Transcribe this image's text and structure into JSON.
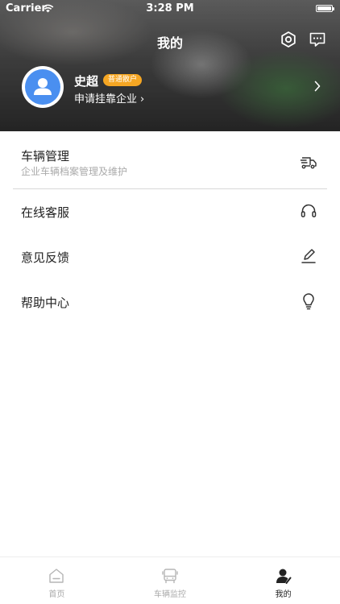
{
  "status_bar": {
    "carrier": "Carrier",
    "time": "3:28 PM"
  },
  "header": {
    "title": "我的"
  },
  "profile": {
    "name": "史超",
    "badge": "普通散户",
    "subtitle": "申请挂靠企业",
    "avatar_color": "#4a8ff0",
    "badge_color": "#f5a623"
  },
  "menu": {
    "items": [
      {
        "label": "车辆管理",
        "desc": "企业车辆档案管理及维护",
        "icon": "truck-icon"
      },
      {
        "label": "在线客服",
        "icon": "headset-icon"
      },
      {
        "label": "意见反馈",
        "icon": "edit-icon"
      },
      {
        "label": "帮助中心",
        "icon": "lightbulb-icon"
      }
    ]
  },
  "tabbar": {
    "tabs": [
      {
        "label": "首页",
        "icon": "home-icon",
        "active": false
      },
      {
        "label": "车辆监控",
        "icon": "bus-icon",
        "active": false
      },
      {
        "label": "我的",
        "icon": "user-icon",
        "active": true
      }
    ]
  }
}
